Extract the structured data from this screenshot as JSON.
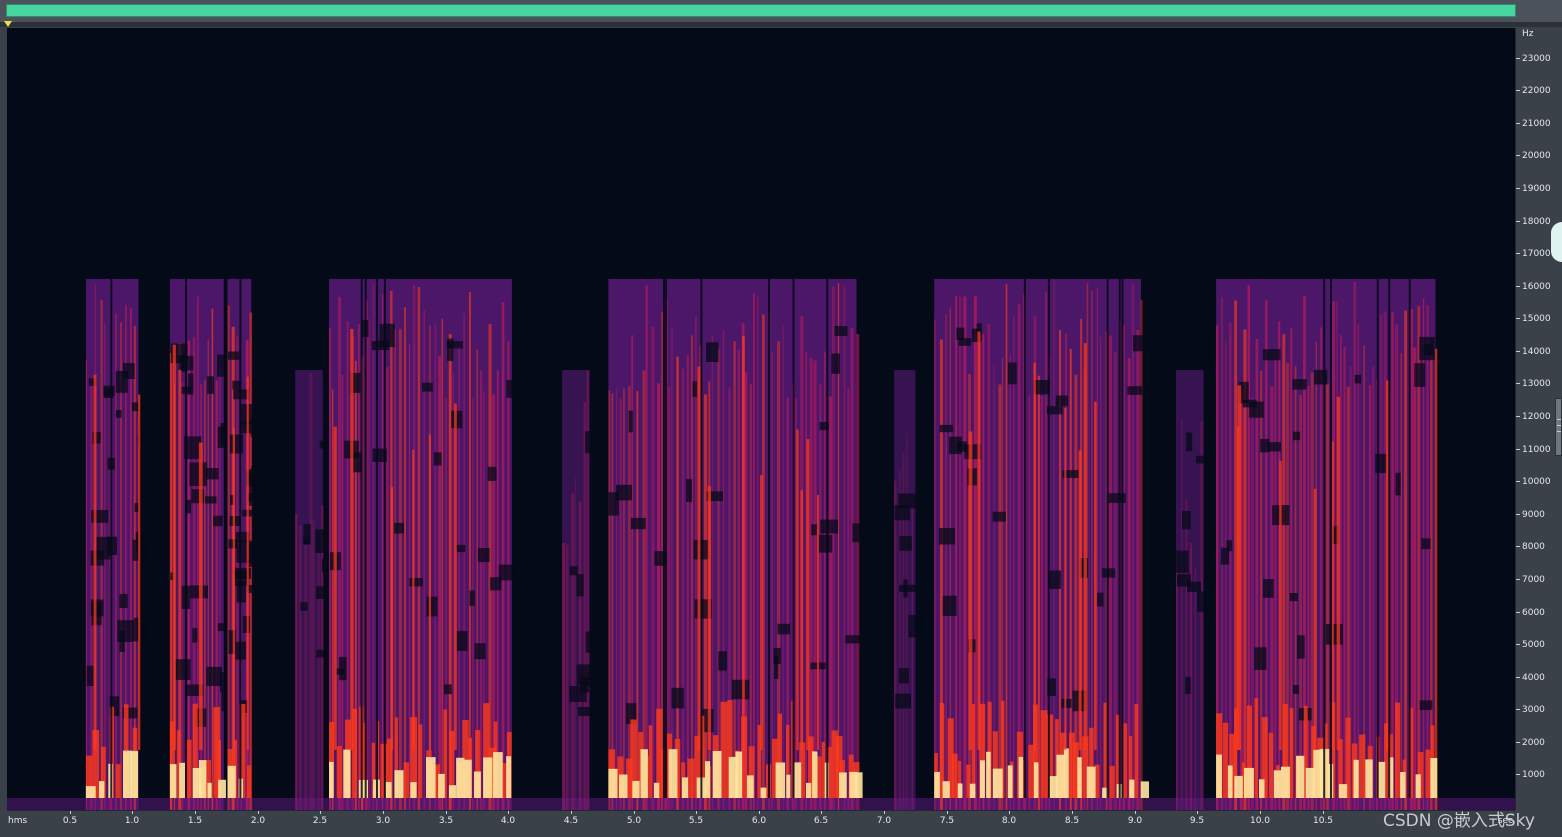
{
  "overview": {
    "range_color": "#47d6a0"
  },
  "frequency_axis": {
    "unit": "Hz",
    "ticks": [
      {
        "value": 1000,
        "label": "1000"
      },
      {
        "value": 2000,
        "label": "2000"
      },
      {
        "value": 3000,
        "label": "3000"
      },
      {
        "value": 4000,
        "label": "4000"
      },
      {
        "value": 5000,
        "label": "5000"
      },
      {
        "value": 6000,
        "label": "6000"
      },
      {
        "value": 7000,
        "label": "7000"
      },
      {
        "value": 8000,
        "label": "8000"
      },
      {
        "value": 9000,
        "label": "9000"
      },
      {
        "value": 10000,
        "label": "10000"
      },
      {
        "value": 11000,
        "label": "11000"
      },
      {
        "value": 12000,
        "label": "12000"
      },
      {
        "value": 13000,
        "label": "13000"
      },
      {
        "value": 14000,
        "label": "14000"
      },
      {
        "value": 15000,
        "label": "15000"
      },
      {
        "value": 16000,
        "label": "16000"
      },
      {
        "value": 17000,
        "label": "17000"
      },
      {
        "value": 18000,
        "label": "18000"
      },
      {
        "value": 19000,
        "label": "19000"
      },
      {
        "value": 20000,
        "label": "20000"
      },
      {
        "value": 21000,
        "label": "21000"
      },
      {
        "value": 22000,
        "label": "22000"
      },
      {
        "value": 23000,
        "label": "23000"
      }
    ],
    "range_hz": [
      0,
      24000
    ]
  },
  "time_axis": {
    "start_label": "hms",
    "end_label": "sec",
    "ticks": [
      {
        "value": 0.5,
        "label": "0.5"
      },
      {
        "value": 1.0,
        "label": "1.0"
      },
      {
        "value": 1.5,
        "label": "1.5"
      },
      {
        "value": 2.0,
        "label": "2.0"
      },
      {
        "value": 2.5,
        "label": "2.5"
      },
      {
        "value": 3.0,
        "label": "3.0"
      },
      {
        "value": 3.5,
        "label": "3.5"
      },
      {
        "value": 4.0,
        "label": "4.0"
      },
      {
        "value": 4.5,
        "label": "4.5"
      },
      {
        "value": 5.0,
        "label": "5.0"
      },
      {
        "value": 5.5,
        "label": "5.5"
      },
      {
        "value": 6.0,
        "label": "6.0"
      },
      {
        "value": 6.5,
        "label": "6.5"
      },
      {
        "value": 7.0,
        "label": "7.0"
      },
      {
        "value": 7.5,
        "label": "7.5"
      },
      {
        "value": 8.0,
        "label": "8.0"
      },
      {
        "value": 8.5,
        "label": "8.5"
      },
      {
        "value": 9.0,
        "label": "9.0"
      },
      {
        "value": 9.5,
        "label": "9.5"
      },
      {
        "value": 10.0,
        "label": "10.0"
      },
      {
        "value": 10.5,
        "label": "10.5"
      }
    ],
    "range_sec": [
      0,
      12.0
    ]
  },
  "speech_segments_sec": [
    {
      "start": 0.63,
      "end": 1.05,
      "intensity": "high"
    },
    {
      "start": 1.3,
      "end": 1.73,
      "intensity": "high"
    },
    {
      "start": 1.76,
      "end": 1.95,
      "intensity": "high"
    },
    {
      "start": 2.3,
      "end": 2.52,
      "intensity": "low"
    },
    {
      "start": 2.57,
      "end": 4.03,
      "intensity": "high"
    },
    {
      "start": 4.43,
      "end": 4.65,
      "intensity": "low"
    },
    {
      "start": 4.8,
      "end": 6.78,
      "intensity": "high"
    },
    {
      "start": 7.08,
      "end": 7.25,
      "intensity": "low"
    },
    {
      "start": 7.4,
      "end": 9.05,
      "intensity": "high"
    },
    {
      "start": 9.33,
      "end": 9.55,
      "intensity": "low"
    },
    {
      "start": 9.65,
      "end": 11.4,
      "intensity": "high"
    }
  ],
  "colors": {
    "background": "#040a18",
    "low_energy": "#5a1a78",
    "mid_energy": "#c21a5a",
    "high_energy": "#ff3a1a",
    "peak_energy": "#ffe8a0"
  },
  "watermark": "CSDN @嵌入式Sky"
}
